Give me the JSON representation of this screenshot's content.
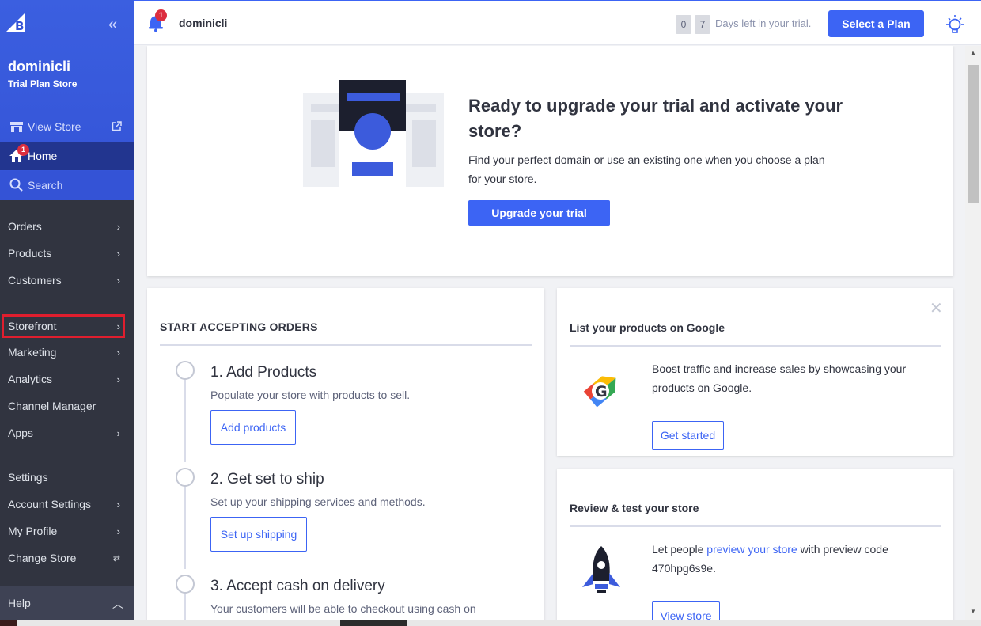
{
  "sidebar": {
    "store_name": "dominicli",
    "plan_name": "Trial Plan Store",
    "collapse_label": "«",
    "view_store": "View Store",
    "home": "Home",
    "home_badge": "1",
    "search": "Search",
    "nav": {
      "orders": "Orders",
      "products": "Products",
      "customers": "Customers",
      "storefront": "Storefront",
      "marketing": "Marketing",
      "analytics": "Analytics",
      "channel_manager": "Channel Manager",
      "apps": "Apps",
      "settings": "Settings",
      "account_settings": "Account Settings",
      "my_profile": "My Profile",
      "change_store": "Change Store"
    },
    "help": "Help"
  },
  "header": {
    "notification_count": "1",
    "store_name": "dominicli",
    "days_digit_1": "0",
    "days_digit_2": "7",
    "trial_text": "Days left in your trial.",
    "select_plan": "Select a Plan"
  },
  "upgrade": {
    "title": "Ready to upgrade your trial and activate your store?",
    "description": "Find your perfect domain or use an existing one when you choose a plan for your store.",
    "button": "Upgrade your trial"
  },
  "orders": {
    "title": "START ACCEPTING ORDERS",
    "steps": [
      {
        "title": "1. Add Products",
        "description": "Populate your store with products to sell.",
        "button": "Add products"
      },
      {
        "title": "2. Get set to ship",
        "description": "Set up your shipping services and methods.",
        "button": "Set up shipping"
      },
      {
        "title": "3. Accept cash on delivery",
        "description": "Your customers will be able to checkout using cash on"
      }
    ]
  },
  "google": {
    "title": "List your products on Google",
    "text": "Boost traffic and increase sales by showcasing your products on Google.",
    "button": "Get started"
  },
  "review": {
    "title": "Review & test your store",
    "text_before": "Let people ",
    "link": "preview your store",
    "text_after": " with preview code 470hpg6s9e.",
    "button": "View store"
  },
  "colors": {
    "brand_blue": "#3c64f4",
    "sidebar_bg": "#313440",
    "badge_red": "#dc2e3f",
    "highlight_red": "#e01e2e"
  }
}
